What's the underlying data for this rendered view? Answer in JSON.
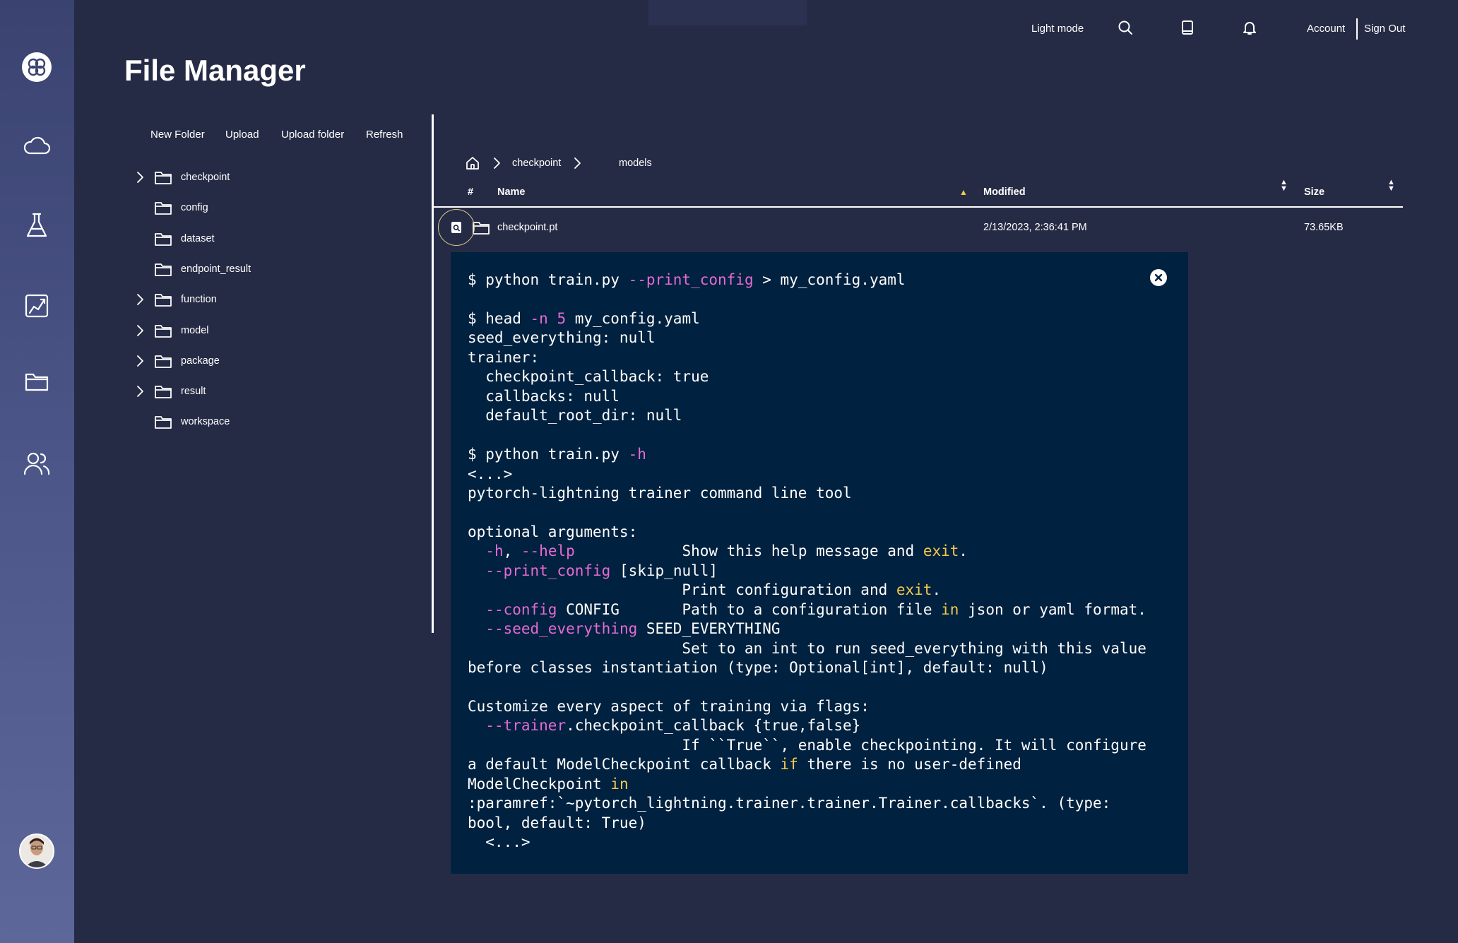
{
  "header": {
    "light_mode_label": "Light mode",
    "account_label": "Account",
    "sign_out_label": "Sign Out",
    "icons": [
      "search-icon",
      "book-icon",
      "bell-icon"
    ]
  },
  "sidebar": {
    "items": [
      {
        "name": "logo",
        "icon": "logo-icon"
      },
      {
        "name": "cloud",
        "icon": "cloud-icon"
      },
      {
        "name": "experiments",
        "icon": "flask-icon"
      },
      {
        "name": "models",
        "icon": "chart-icon"
      },
      {
        "name": "files",
        "icon": "folder-icon"
      },
      {
        "name": "users",
        "icon": "users-icon"
      }
    ],
    "avatar": "avatar"
  },
  "page": {
    "title": "File Manager"
  },
  "actions": {
    "new_folder": "New Folder",
    "upload": "Upload",
    "upload_folder": "Upload folder",
    "refresh": "Refresh"
  },
  "tree": {
    "items": [
      {
        "label": "checkpoint",
        "expandable": true
      },
      {
        "label": "config",
        "expandable": false
      },
      {
        "label": "dataset",
        "expandable": false
      },
      {
        "label": "endpoint_result",
        "expandable": false
      },
      {
        "label": "function",
        "expandable": true
      },
      {
        "label": "model",
        "expandable": true
      },
      {
        "label": "package",
        "expandable": true
      },
      {
        "label": "result",
        "expandable": true
      },
      {
        "label": "workspace",
        "expandable": false
      }
    ]
  },
  "breadcrumb": {
    "items": [
      "checkpoint",
      "models"
    ]
  },
  "table": {
    "headers": {
      "index": "#",
      "name": "Name",
      "modified": "Modified",
      "size": "Size"
    },
    "rows": [
      {
        "name": "checkpoint.pt",
        "modified": "2/13/2023, 2:36:41 PM",
        "size": "73.65KB"
      }
    ]
  },
  "console": {
    "lines": [
      [
        [
          "",
          "$ python train.py "
        ],
        [
          "opt",
          "--print_config"
        ],
        [
          "",
          " > my_config.yaml"
        ]
      ],
      [
        [
          "",
          ""
        ]
      ],
      [
        [
          "",
          "$ head "
        ],
        [
          "opt",
          "-n 5"
        ],
        [
          "",
          " my_config.yaml"
        ]
      ],
      [
        [
          "",
          "seed_everything: null"
        ]
      ],
      [
        [
          "",
          "trainer:"
        ]
      ],
      [
        [
          "",
          "  checkpoint_callback: true"
        ]
      ],
      [
        [
          "",
          "  callbacks: null"
        ]
      ],
      [
        [
          "",
          "  default_root_dir: null"
        ]
      ],
      [
        [
          "",
          ""
        ]
      ],
      [
        [
          "",
          "$ python train.py "
        ],
        [
          "opt",
          "-h"
        ]
      ],
      [
        [
          "",
          "<...>"
        ]
      ],
      [
        [
          "",
          "pytorch-lightning trainer command line tool"
        ]
      ],
      [
        [
          "",
          ""
        ]
      ],
      [
        [
          "",
          "optional arguments:"
        ]
      ],
      [
        [
          "",
          "  "
        ],
        [
          "opt",
          "-h"
        ],
        [
          "",
          ", "
        ],
        [
          "opt",
          "--help"
        ],
        [
          "",
          "            Show this help message and "
        ],
        [
          "kw",
          "exit"
        ],
        [
          "",
          "."
        ]
      ],
      [
        [
          "",
          "  "
        ],
        [
          "opt",
          "--print_config"
        ],
        [
          "",
          " [skip_null]"
        ]
      ],
      [
        [
          "",
          "                        Print configuration and "
        ],
        [
          "kw",
          "exit"
        ],
        [
          "",
          "."
        ]
      ],
      [
        [
          "",
          "  "
        ],
        [
          "opt",
          "--config"
        ],
        [
          "",
          " CONFIG       Path to a configuration file "
        ],
        [
          "kw",
          "in"
        ],
        [
          "",
          " json or yaml format."
        ]
      ],
      [
        [
          "",
          "  "
        ],
        [
          "opt",
          "--seed_everything"
        ],
        [
          "",
          " SEED_EVERYTHING"
        ]
      ],
      [
        [
          "",
          "                        Set to an int to run seed_everything with this value"
        ]
      ],
      [
        [
          "",
          "before classes instantiation (type: Optional[int], default: null)"
        ]
      ],
      [
        [
          "",
          ""
        ]
      ],
      [
        [
          "",
          "Customize every aspect of training via flags:"
        ]
      ],
      [
        [
          "",
          "  "
        ],
        [
          "opt",
          "--trainer"
        ],
        [
          "",
          ".checkpoint_callback {true,false}"
        ]
      ],
      [
        [
          "",
          "                        If ``True``, enable checkpointing. It will configure"
        ]
      ],
      [
        [
          "",
          "a default ModelCheckpoint callback "
        ],
        [
          "kw",
          "if"
        ],
        [
          "",
          " there is no user-defined"
        ]
      ],
      [
        [
          "",
          "ModelCheckpoint "
        ],
        [
          "kw",
          "in"
        ]
      ],
      [
        [
          "",
          ":paramref:`~pytorch_lightning.trainer.trainer.Trainer.callbacks`. (type:"
        ]
      ],
      [
        [
          "",
          "bool, default: True)"
        ]
      ],
      [
        [
          "",
          "  <...>"
        ]
      ]
    ]
  },
  "colors": {
    "background": "#262b45",
    "console_bg": "#00213f",
    "option": "#e46bd2",
    "keyword": "#f2c94c"
  }
}
